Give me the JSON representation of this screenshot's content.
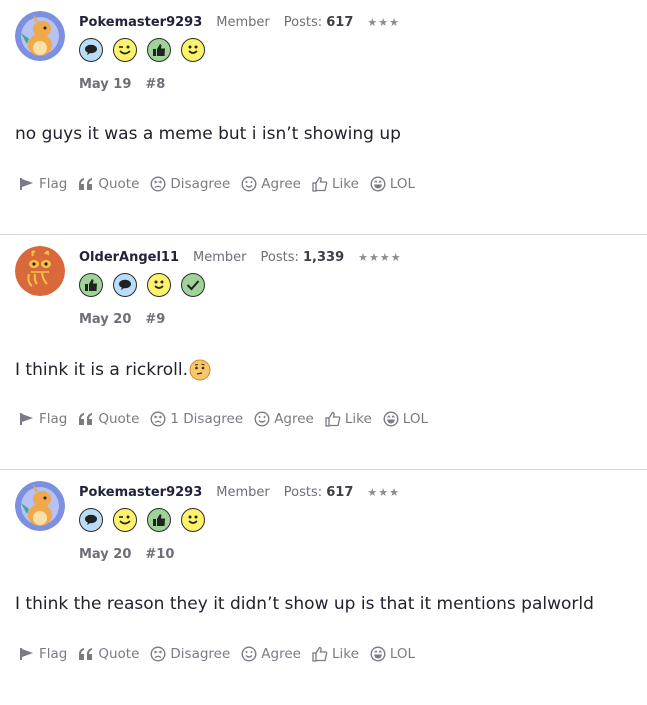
{
  "posts": [
    {
      "username": "Pokemaster9293",
      "role": "Member",
      "posts_label": "Posts:",
      "posts_count": "617",
      "stars": "★★★",
      "date": "May 19",
      "number": "#8",
      "body": "no guys it was a meme but i isn’t showing up",
      "badges": [
        "speech-bubble",
        "wink",
        "thumbs-up",
        "smile"
      ],
      "actions": {
        "flag": "Flag",
        "quote": "Quote",
        "disagree": "Disagree",
        "agree": "Agree",
        "like": "Like",
        "lol": "LOL"
      }
    },
    {
      "username": "OlderAngel11",
      "role": "Member",
      "posts_label": "Posts:",
      "posts_count": "1,339",
      "stars": "★★★★",
      "date": "May 20",
      "number": "#9",
      "body": "I think it is a rickroll.",
      "badges": [
        "thumbs-up",
        "speech-bubble",
        "smile",
        "check"
      ],
      "actions": {
        "flag": "Flag",
        "quote": "Quote",
        "disagree": "1 Disagree",
        "agree": "Agree",
        "like": "Like",
        "lol": "LOL"
      }
    },
    {
      "username": "Pokemaster9293",
      "role": "Member",
      "posts_label": "Posts:",
      "posts_count": "617",
      "stars": "★★★",
      "date": "May 20",
      "number": "#10",
      "body": "I think the reason they it didn’t show up is that it mentions palworld",
      "badges": [
        "speech-bubble",
        "wink",
        "thumbs-up",
        "smile"
      ],
      "actions": {
        "flag": "Flag",
        "quote": "Quote",
        "disagree": "Disagree",
        "agree": "Agree",
        "like": "Like",
        "lol": "LOL"
      }
    }
  ],
  "colors": {
    "badge_blue": "#b9dcf7",
    "badge_yellow": "#fdf36a",
    "badge_green": "#9fd39a",
    "avatar_blue": "#7d8fe0",
    "avatar_orange": "#d9693a"
  }
}
